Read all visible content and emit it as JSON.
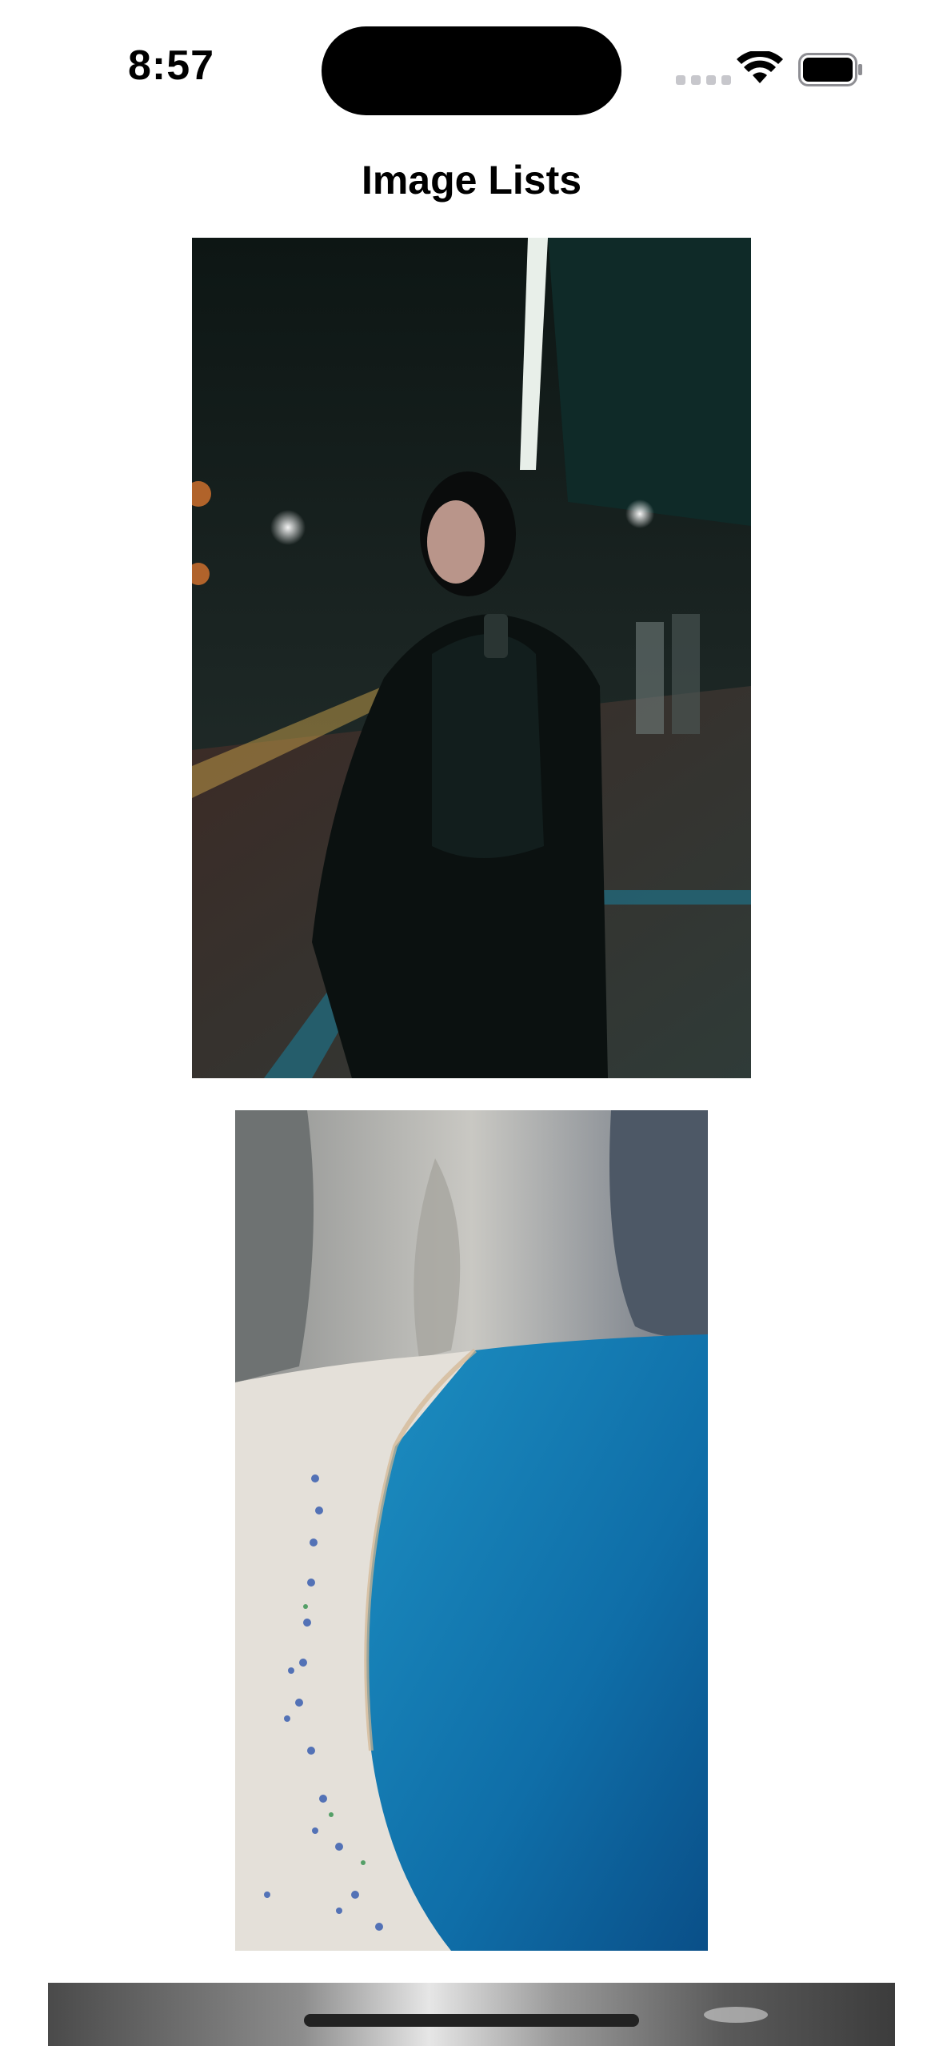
{
  "status_bar": {
    "time": "8:57",
    "icons": [
      "cellular-signal-icon",
      "wifi-icon",
      "battery-icon"
    ]
  },
  "header": {
    "title": "Image Lists"
  },
  "images": [
    {
      "name": "woman-in-subway-photo",
      "description_icon": "photo"
    },
    {
      "name": "beach-aerial-photo",
      "description_icon": "photo"
    },
    {
      "name": "grey-partial-photo",
      "description_icon": "photo"
    }
  ],
  "colors": {
    "background": "#ffffff",
    "text": "#000000"
  }
}
